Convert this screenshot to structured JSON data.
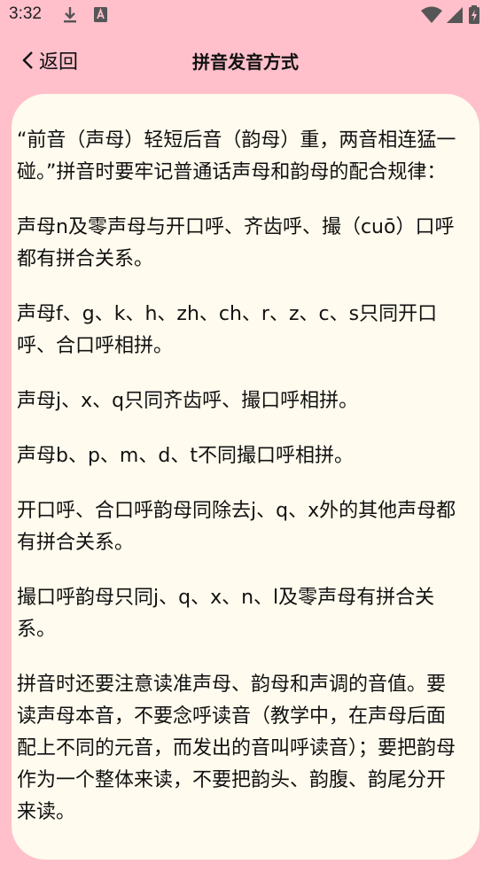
{
  "status_bar": {
    "time": "3:32",
    "left_icons": [
      "download-icon",
      "a-app-icon"
    ],
    "right_icons": [
      "wifi-icon",
      "signal-icon",
      "battery-charging-icon"
    ]
  },
  "header": {
    "back_label": "返回",
    "title": "拼音发音方式"
  },
  "content": {
    "paragraphs": [
      "“前音（声母）轻短后音（韵母）重，两音相连猛一碰。”拼音时要牢记普通话声母和韵母的配合规律：",
      "声母n及零声母与开口呼、齐齿呼、撮（cuō）口呼都有拼合关系。",
      "声母f、g、k、h、zh、ch、r、z、c、s只同开口呼、合口呼相拼。",
      "声母j、x、q只同齐齿呼、撮口呼相拼。",
      "声母b、p、m、d、t不同撮口呼相拼。",
      "开口呼、合口呼韵母同除去j、q、x外的其他声母都有拼合关系。",
      "撮口呼韵母只同j、q、x、n、l及零声母有拼合关系。",
      "拼音时还要注意读准声母、韵母和声调的音值。要读声母本音，不要念呼读音（教学中，在声母后面配上不同的元音，而发出的音叫呼读音）；要把韵母作为一个整体来读，不要把韵头、韵腹、韵尾分开来读。"
    ]
  },
  "colors": {
    "background": "#ffc0cb",
    "card": "#fffbee",
    "text": "#111111"
  }
}
